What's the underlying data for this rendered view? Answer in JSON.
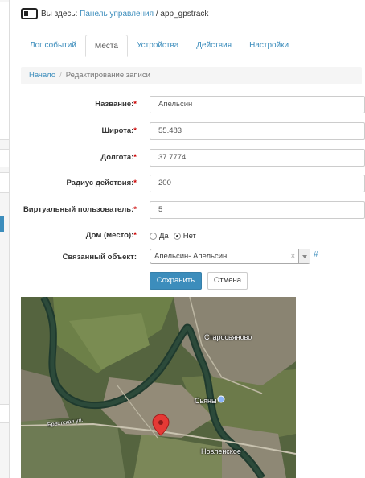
{
  "header": {
    "you_are_here": "Вы здесь:",
    "dashboard_link": "Панель управления",
    "separator": "/",
    "module": "app_gpstrack"
  },
  "tabs": [
    {
      "label": "Лог событий",
      "active": false
    },
    {
      "label": "Места",
      "active": true
    },
    {
      "label": "Устройства",
      "active": false
    },
    {
      "label": "Действия",
      "active": false
    },
    {
      "label": "Настройки",
      "active": false
    }
  ],
  "breadcrumb": {
    "home": "Начало",
    "sep": "/",
    "current": "Редактирование записи"
  },
  "form": {
    "required_mark": "*",
    "name": {
      "label": "Название:",
      "value": "Апельсин"
    },
    "latitude": {
      "label": "Широта:",
      "value": "55.483"
    },
    "longitude": {
      "label": "Долгота:",
      "value": "37.7774"
    },
    "radius": {
      "label": "Радиус действия:",
      "value": "200"
    },
    "virtual_user": {
      "label": "Виртуальный пользователь:",
      "value": "5"
    },
    "home": {
      "label": "Дом (место):",
      "option_yes": "Да",
      "option_no": "Нет",
      "selected": "Нет"
    },
    "related": {
      "label": "Связанный объект:",
      "value": "Апельсин- Апельсин",
      "clear": "×",
      "link": "#"
    },
    "save_label": "Сохранить",
    "cancel_label": "Отмена"
  },
  "map": {
    "labels": {
      "village_north": "Старосьяново",
      "village_east": "Сьяны",
      "village_south": "Новленское",
      "street": "Брестская ул."
    },
    "marker_color": "#e53935"
  },
  "colors": {
    "accent": "#3c8dbc",
    "required": "#cc0000"
  }
}
